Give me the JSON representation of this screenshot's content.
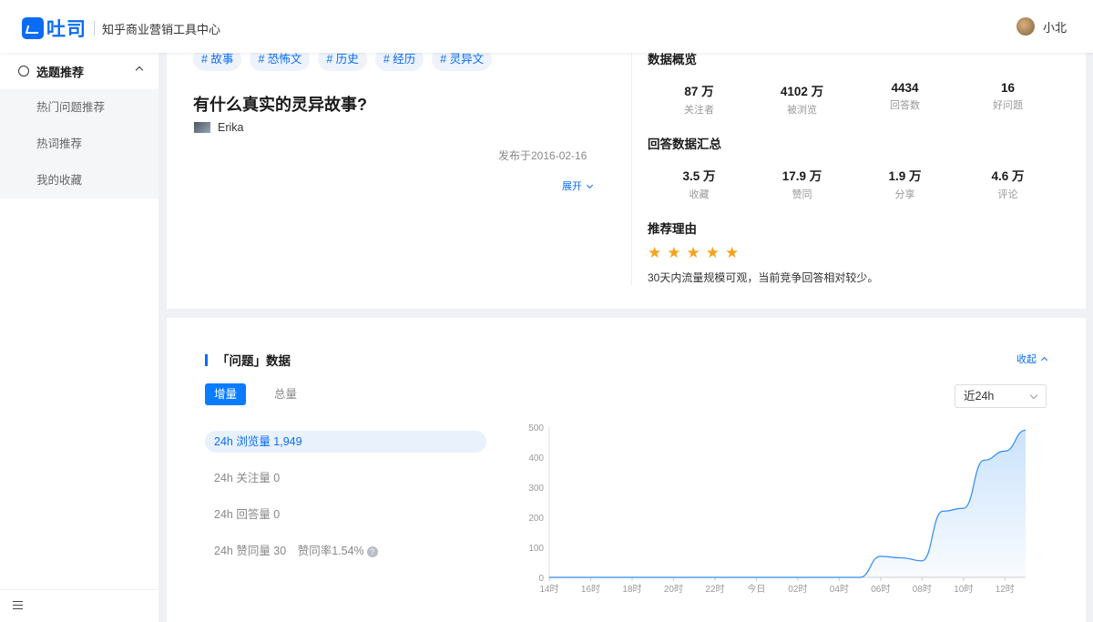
{
  "header": {
    "logo_text": "吐司",
    "subtitle": "知乎商业营销工具中心",
    "username": "小北"
  },
  "sidebar": {
    "group_label": "选题推荐",
    "items": [
      {
        "label": "热门问题推荐"
      },
      {
        "label": "热词推荐"
      },
      {
        "label": "我的收藏"
      }
    ]
  },
  "question": {
    "tags": [
      "# 故事",
      "# 恐怖文",
      "# 历史",
      "# 经历",
      "# 灵异文"
    ],
    "title": "有什么真实的灵异故事?",
    "author": "Erika",
    "published": "发布于2016-02-16",
    "expand_label": "展开"
  },
  "overview": {
    "heading": "数据概览",
    "stats": [
      {
        "value": "87 万",
        "label": "关注者"
      },
      {
        "value": "4102 万",
        "label": "被浏览"
      },
      {
        "value": "4434",
        "label": "回答数"
      },
      {
        "value": "16",
        "label": "好问题"
      }
    ]
  },
  "answers_summary": {
    "heading": "回答数据汇总",
    "stats": [
      {
        "value": "3.5 万",
        "label": "收藏"
      },
      {
        "value": "17.9 万",
        "label": "赞同"
      },
      {
        "value": "1.9 万",
        "label": "分享"
      },
      {
        "value": "4.6 万",
        "label": "评论"
      }
    ]
  },
  "recommendation": {
    "heading": "推荐理由",
    "rating": 5,
    "star_color": "#f7a21c",
    "reason": "30天内流量规模可观，当前竞争回答相对较少。"
  },
  "data_panel": {
    "title": "「问题」数据",
    "collapse_label": "收起",
    "tab_active": "增量",
    "tab_inactive": "总量",
    "range_select": "近24h",
    "metrics": [
      "24h 浏览量 1,949",
      "24h 关注量 0",
      "24h 回答量 0",
      "24h 赞同量 30　赞同率1.54%"
    ],
    "help_icon": "?"
  },
  "chart_data": {
    "type": "area",
    "x": [
      "14时",
      "15时",
      "16时",
      "17时",
      "18时",
      "19时",
      "20时",
      "21时",
      "22时",
      "23时",
      "今日",
      "01时",
      "02时",
      "03时",
      "04时",
      "05时",
      "06时",
      "07时",
      "08时",
      "09时",
      "10时",
      "11时",
      "12时",
      "13时"
    ],
    "xticks": [
      "14时",
      "16时",
      "18时",
      "20时",
      "22时",
      "今日",
      "02时",
      "04时",
      "06时",
      "08时",
      "10时",
      "12时"
    ],
    "series": [
      {
        "values": [
          0,
          0,
          0,
          0,
          0,
          0,
          0,
          0,
          0,
          0,
          0,
          0,
          0,
          0,
          0,
          0,
          70,
          65,
          55,
          220,
          230,
          390,
          420,
          490
        ]
      }
    ],
    "ylim": [
      0,
      500
    ],
    "yticks": [
      0,
      100,
      200,
      300,
      400,
      500
    ],
    "color": "#2d8cf0"
  }
}
